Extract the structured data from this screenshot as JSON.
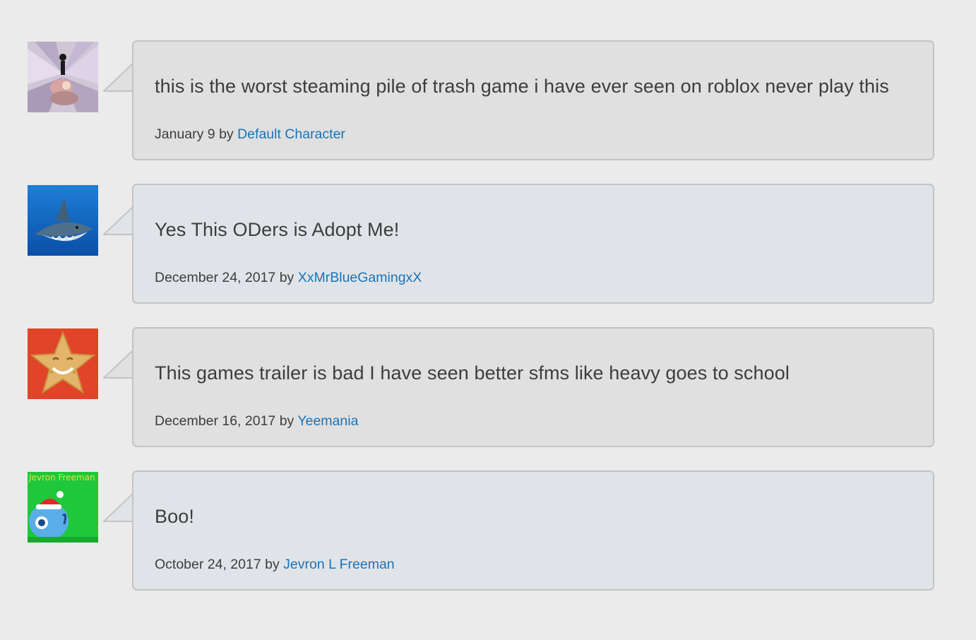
{
  "comments": [
    {
      "text": "this is the worst steaming pile of trash game i have ever seen on roblox never play this",
      "date": "January 9",
      "by": "by",
      "author": "Default Character",
      "avatar_icon": "angelic-figure-avatar-icon"
    },
    {
      "text": "Yes This ODers is Adopt Me!",
      "date": "December 24, 2017",
      "by": "by",
      "author": "XxMrBlueGamingxX",
      "avatar_icon": "shark-avatar-icon"
    },
    {
      "text": "This games trailer is bad I have seen better sfms like heavy goes to school",
      "date": "December 16, 2017",
      "by": "by",
      "author": "Yeemania",
      "avatar_icon": "smiling-star-cookie-avatar-icon"
    },
    {
      "text": "Boo!",
      "date": "October 24, 2017",
      "by": "by",
      "author": "Jevron L Freeman",
      "avatar_icon": "blue-character-santa-hat-avatar-icon"
    }
  ],
  "avatar_captions": {
    "jevron_top": "Jevron Freeman"
  },
  "colors": {
    "page_background": "#ebebeb",
    "bubble_gray": "#e0e0e0",
    "bubble_blue": "#e0e4e8",
    "bubble_border": "#c3c3c3",
    "text": "#3d3d3d",
    "link": "#1a73b8"
  }
}
